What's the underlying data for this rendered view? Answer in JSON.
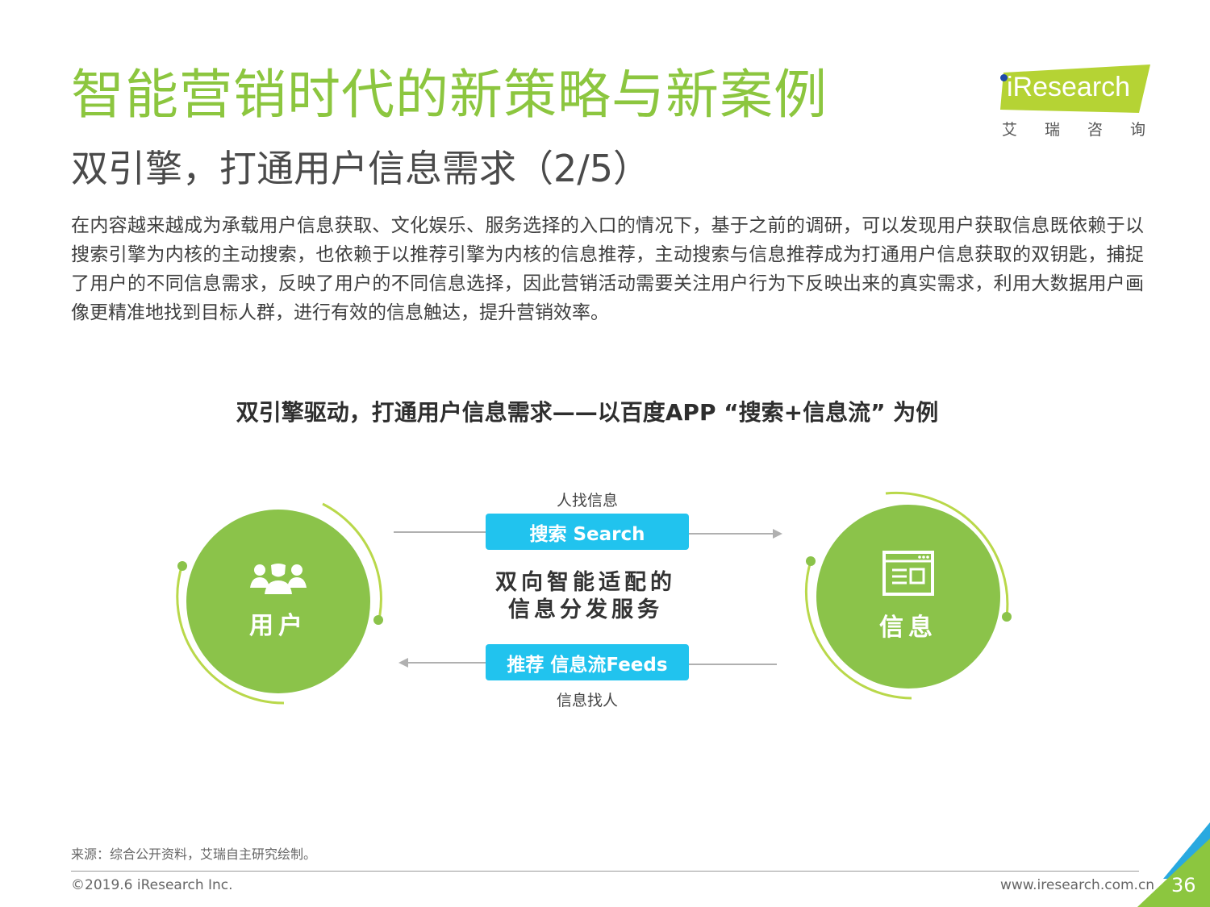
{
  "header": {
    "title": "智能营销时代的新策略与新案例",
    "subtitle": "双引擎，打通用户信息需求（2/5）",
    "logo_text": "iResearch",
    "logo_cn": "艾瑞咨询"
  },
  "body_paragraph": "在内容越来越成为承载用户信息获取、文化娱乐、服务选择的入口的情况下，基于之前的调研，可以发现用户获取信息既依赖于以搜索引擎为内核的主动搜索，也依赖于以推荐引擎为内核的信息推荐，主动搜索与信息推荐成为打通用户信息获取的双钥匙，捕捉了用户的不同信息需求，反映了用户的不同信息选择，因此营销活动需要关注用户行为下反映出来的真实需求，利用大数据用户画像更精准地找到目标人群，进行有效的信息触达，提升营销效率。",
  "diagram": {
    "title": "双引擎驱动，打通用户信息需求——以百度APP “搜索+信息流” 为例",
    "left_node": {
      "label": "用户",
      "icon": "users-group-icon"
    },
    "right_node": {
      "label": "信息",
      "icon": "browser-window-icon"
    },
    "top_arrow": {
      "caption": "人找信息",
      "pill": "搜索 Search"
    },
    "bottom_arrow": {
      "caption": "信息找人",
      "pill": "推荐 信息流Feeds"
    },
    "center_line1": "双向智能适配的",
    "center_line2": "信息分发服务"
  },
  "footer": {
    "source": "来源：综合公开资料，艾瑞自主研究绘制。",
    "copyright": "©2019.6 iResearch Inc.",
    "website": "www.iresearch.com.cn",
    "page_number": "36"
  },
  "colors": {
    "green": "#8bc34a",
    "title_green": "#8cc63f",
    "cyan": "#21c3ee",
    "logo_bg": "#b5d334",
    "corner_blue": "#29a9e0"
  }
}
